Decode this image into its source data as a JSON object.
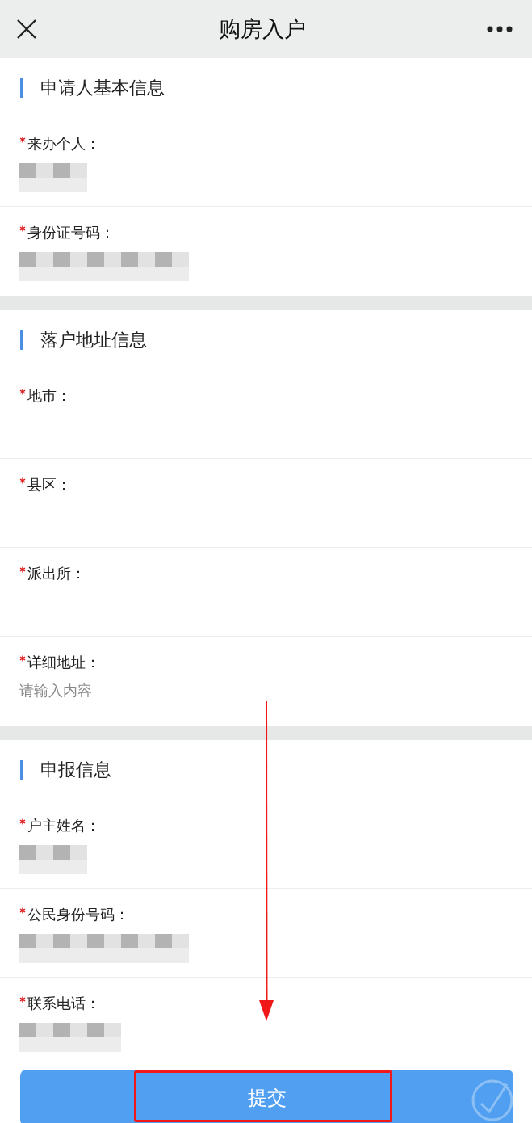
{
  "header": {
    "title": "购房入户"
  },
  "sections": [
    {
      "title": "申请人基本信息",
      "fields": [
        {
          "label": "来办个人：",
          "required": true,
          "kind": "redacted"
        },
        {
          "label": "身份证号码：",
          "required": true,
          "kind": "redacted_long"
        }
      ]
    },
    {
      "title": "落户地址信息",
      "fields": [
        {
          "label": "地市：",
          "required": true,
          "kind": "empty"
        },
        {
          "label": "县区：",
          "required": true,
          "kind": "empty"
        },
        {
          "label": "派出所：",
          "required": true,
          "kind": "empty"
        },
        {
          "label": "详细地址：",
          "required": true,
          "kind": "input",
          "placeholder": "请输入内容"
        }
      ]
    },
    {
      "title": "申报信息",
      "fields": [
        {
          "label": "户主姓名：",
          "required": true,
          "kind": "redacted"
        },
        {
          "label": "公民身份号码：",
          "required": true,
          "kind": "redacted_long"
        },
        {
          "label": "联系电话：",
          "required": true,
          "kind": "redacted_mid"
        }
      ]
    }
  ],
  "submit": {
    "label": "提交"
  }
}
